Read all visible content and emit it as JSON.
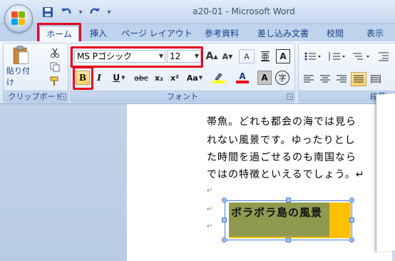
{
  "window": {
    "title": "a20-01 - Microsoft Word"
  },
  "qat": {
    "save_icon": "save-icon",
    "undo_icon": "undo-icon",
    "redo_icon": "redo-icon",
    "customize_glyph": "▾"
  },
  "tabs": [
    {
      "label": "ホーム",
      "active": true
    },
    {
      "label": "挿入",
      "active": false
    },
    {
      "label": "ページ レイアウト",
      "active": false
    },
    {
      "label": "参考資料",
      "active": false
    },
    {
      "label": "差し込み文書",
      "active": false
    },
    {
      "label": "校閲",
      "active": false
    },
    {
      "label": "表示",
      "active": false
    }
  ],
  "ribbon": {
    "clipboard": {
      "group_label": "クリップボード",
      "paste_label": "貼り付け"
    },
    "font": {
      "group_label": "フォント",
      "font_name": "MS Pゴシック",
      "font_size": "12",
      "bold": "B",
      "italic": "I",
      "underline": "U",
      "strikethrough": "abc",
      "subscript": "x₂",
      "superscript": "x²",
      "change_case": "Aa",
      "font_color_glyph": "A",
      "char_shading_glyph": "A",
      "enclose_glyph": "字",
      "grow_glyph": "A",
      "shrink_glyph": "A",
      "clear_format_glyph": "A",
      "phonetic_glyph": "亜",
      "border_glyph": "A",
      "highlight_color": "#ffff00",
      "font_color": "#e8001c"
    },
    "paragraph": {
      "group_label": "段落"
    }
  },
  "document": {
    "lines": [
      "帯魚。どれも都会の海では見ら",
      "れない風景です。ゆったりとし",
      "た時間を過ごせるのも南国なら",
      "ではの特徴といえるでしょう。↵"
    ],
    "paragraph_mark": "↵",
    "textbox_text": "ボラボラ島の風景",
    "textbox_fill": "#ffc000"
  },
  "highlight_color": "#e8001c"
}
